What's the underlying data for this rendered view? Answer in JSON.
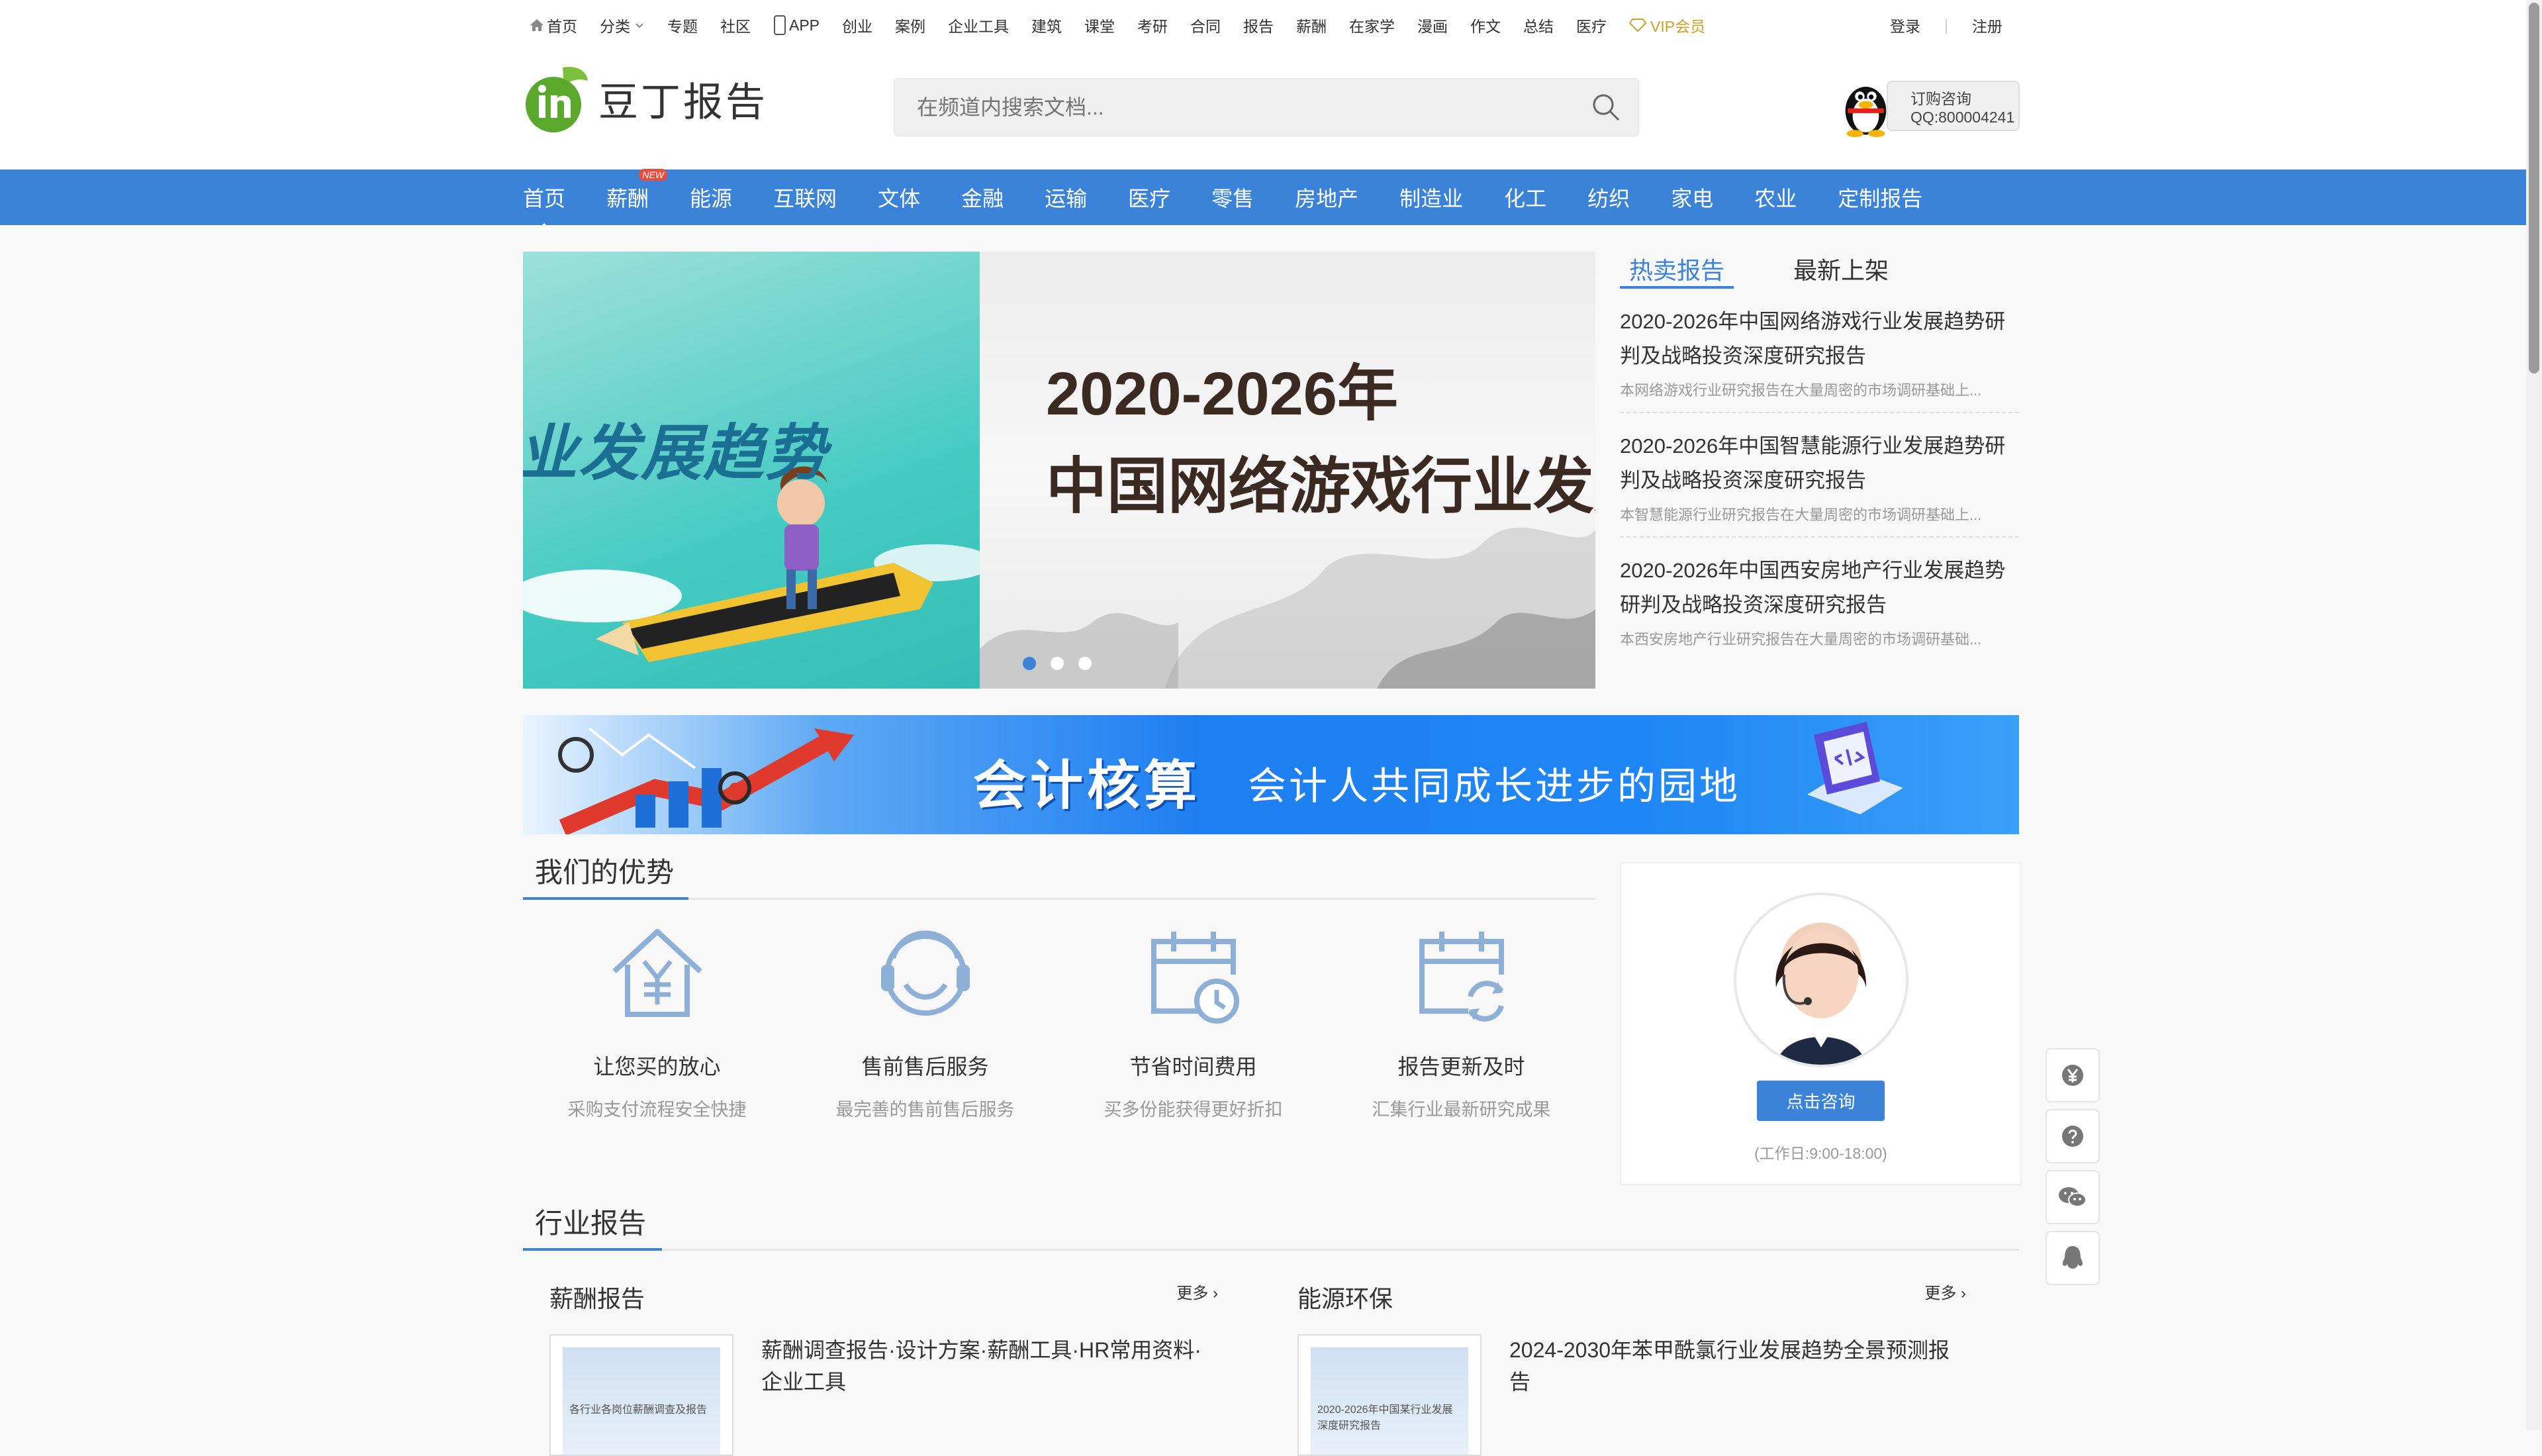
{
  "topnav": {
    "items": [
      "首页",
      "分类",
      "专题",
      "社区",
      "APP",
      "创业",
      "案例",
      "企业工具",
      "建筑",
      "课堂",
      "考研",
      "合同",
      "报告",
      "薪酬",
      "在家学",
      "漫画",
      "作文",
      "总结",
      "医疗"
    ],
    "vip": "VIP会员",
    "login": "登录",
    "register": "注册"
  },
  "header": {
    "logo_text": "豆丁报告",
    "search_placeholder": "在频道内搜索文档...",
    "qq_line1": "订购咨询",
    "qq_line2": "QQ:800004241"
  },
  "mainnav": {
    "items": [
      "首页",
      "薪酬",
      "能源",
      "互联网",
      "文体",
      "金融",
      "运输",
      "医疗",
      "零售",
      "房地产",
      "制造业",
      "化工",
      "纺织",
      "家电",
      "农业",
      "定制报告"
    ],
    "new_tag": "NEW"
  },
  "banner": {
    "left_text": "业发展趋势",
    "right_year": "2020-2026年",
    "right_title": "中国网络游戏行业发展"
  },
  "hot": {
    "tab_hot": "热卖报告",
    "tab_new": "最新上架",
    "items": [
      {
        "title": "2020-2026年中国网络游戏行业发展趋势研判及战略投资深度研究报告",
        "desc": "本网络游戏行业研究报告在大量周密的市场调研基础上..."
      },
      {
        "title": "2020-2026年中国智慧能源行业发展趋势研判及战略投资深度研究报告",
        "desc": "本智慧能源行业研究报告在大量周密的市场调研基础上..."
      },
      {
        "title": "2020-2026年中国西安房地产行业发展趋势研判及战略投资深度研究报告",
        "desc": "本西安房地产行业研究报告在大量周密的市场调研基础..."
      }
    ]
  },
  "ad": {
    "title": "会计核算",
    "slogan": "会计人共同成长进步的园地"
  },
  "advantages": {
    "title": "我们的优势",
    "items": [
      {
        "name": "让您买的放心",
        "sub": "采购支付流程安全快捷"
      },
      {
        "name": "售前售后服务",
        "sub": "最完善的售前售后服务"
      },
      {
        "name": "节省时间费用",
        "sub": "买多份能获得更好折扣"
      },
      {
        "name": "报告更新及时",
        "sub": "汇集行业最新研究成果"
      }
    ]
  },
  "consult": {
    "button": "点击咨询",
    "hours": "(工作日:9:00-18:00)"
  },
  "industry": {
    "title": "行业报告",
    "cols": [
      {
        "head": "薪酬报告",
        "more": "更多 ›",
        "text": "薪酬调查报告·设计方案·薪酬工具·HR常用资料·企业工具",
        "thumb": "各行业各岗位薪酬调查及报告"
      },
      {
        "head": "能源环保",
        "more": "更多 ›",
        "text": "2024-2030年苯甲酰氯行业发展趋势全景预测报告",
        "thumb": "2020-2026年中国某行业发展深度研究报告"
      }
    ]
  },
  "colors": {
    "accent": "#3b83d8",
    "vip": "#c9a12b"
  }
}
